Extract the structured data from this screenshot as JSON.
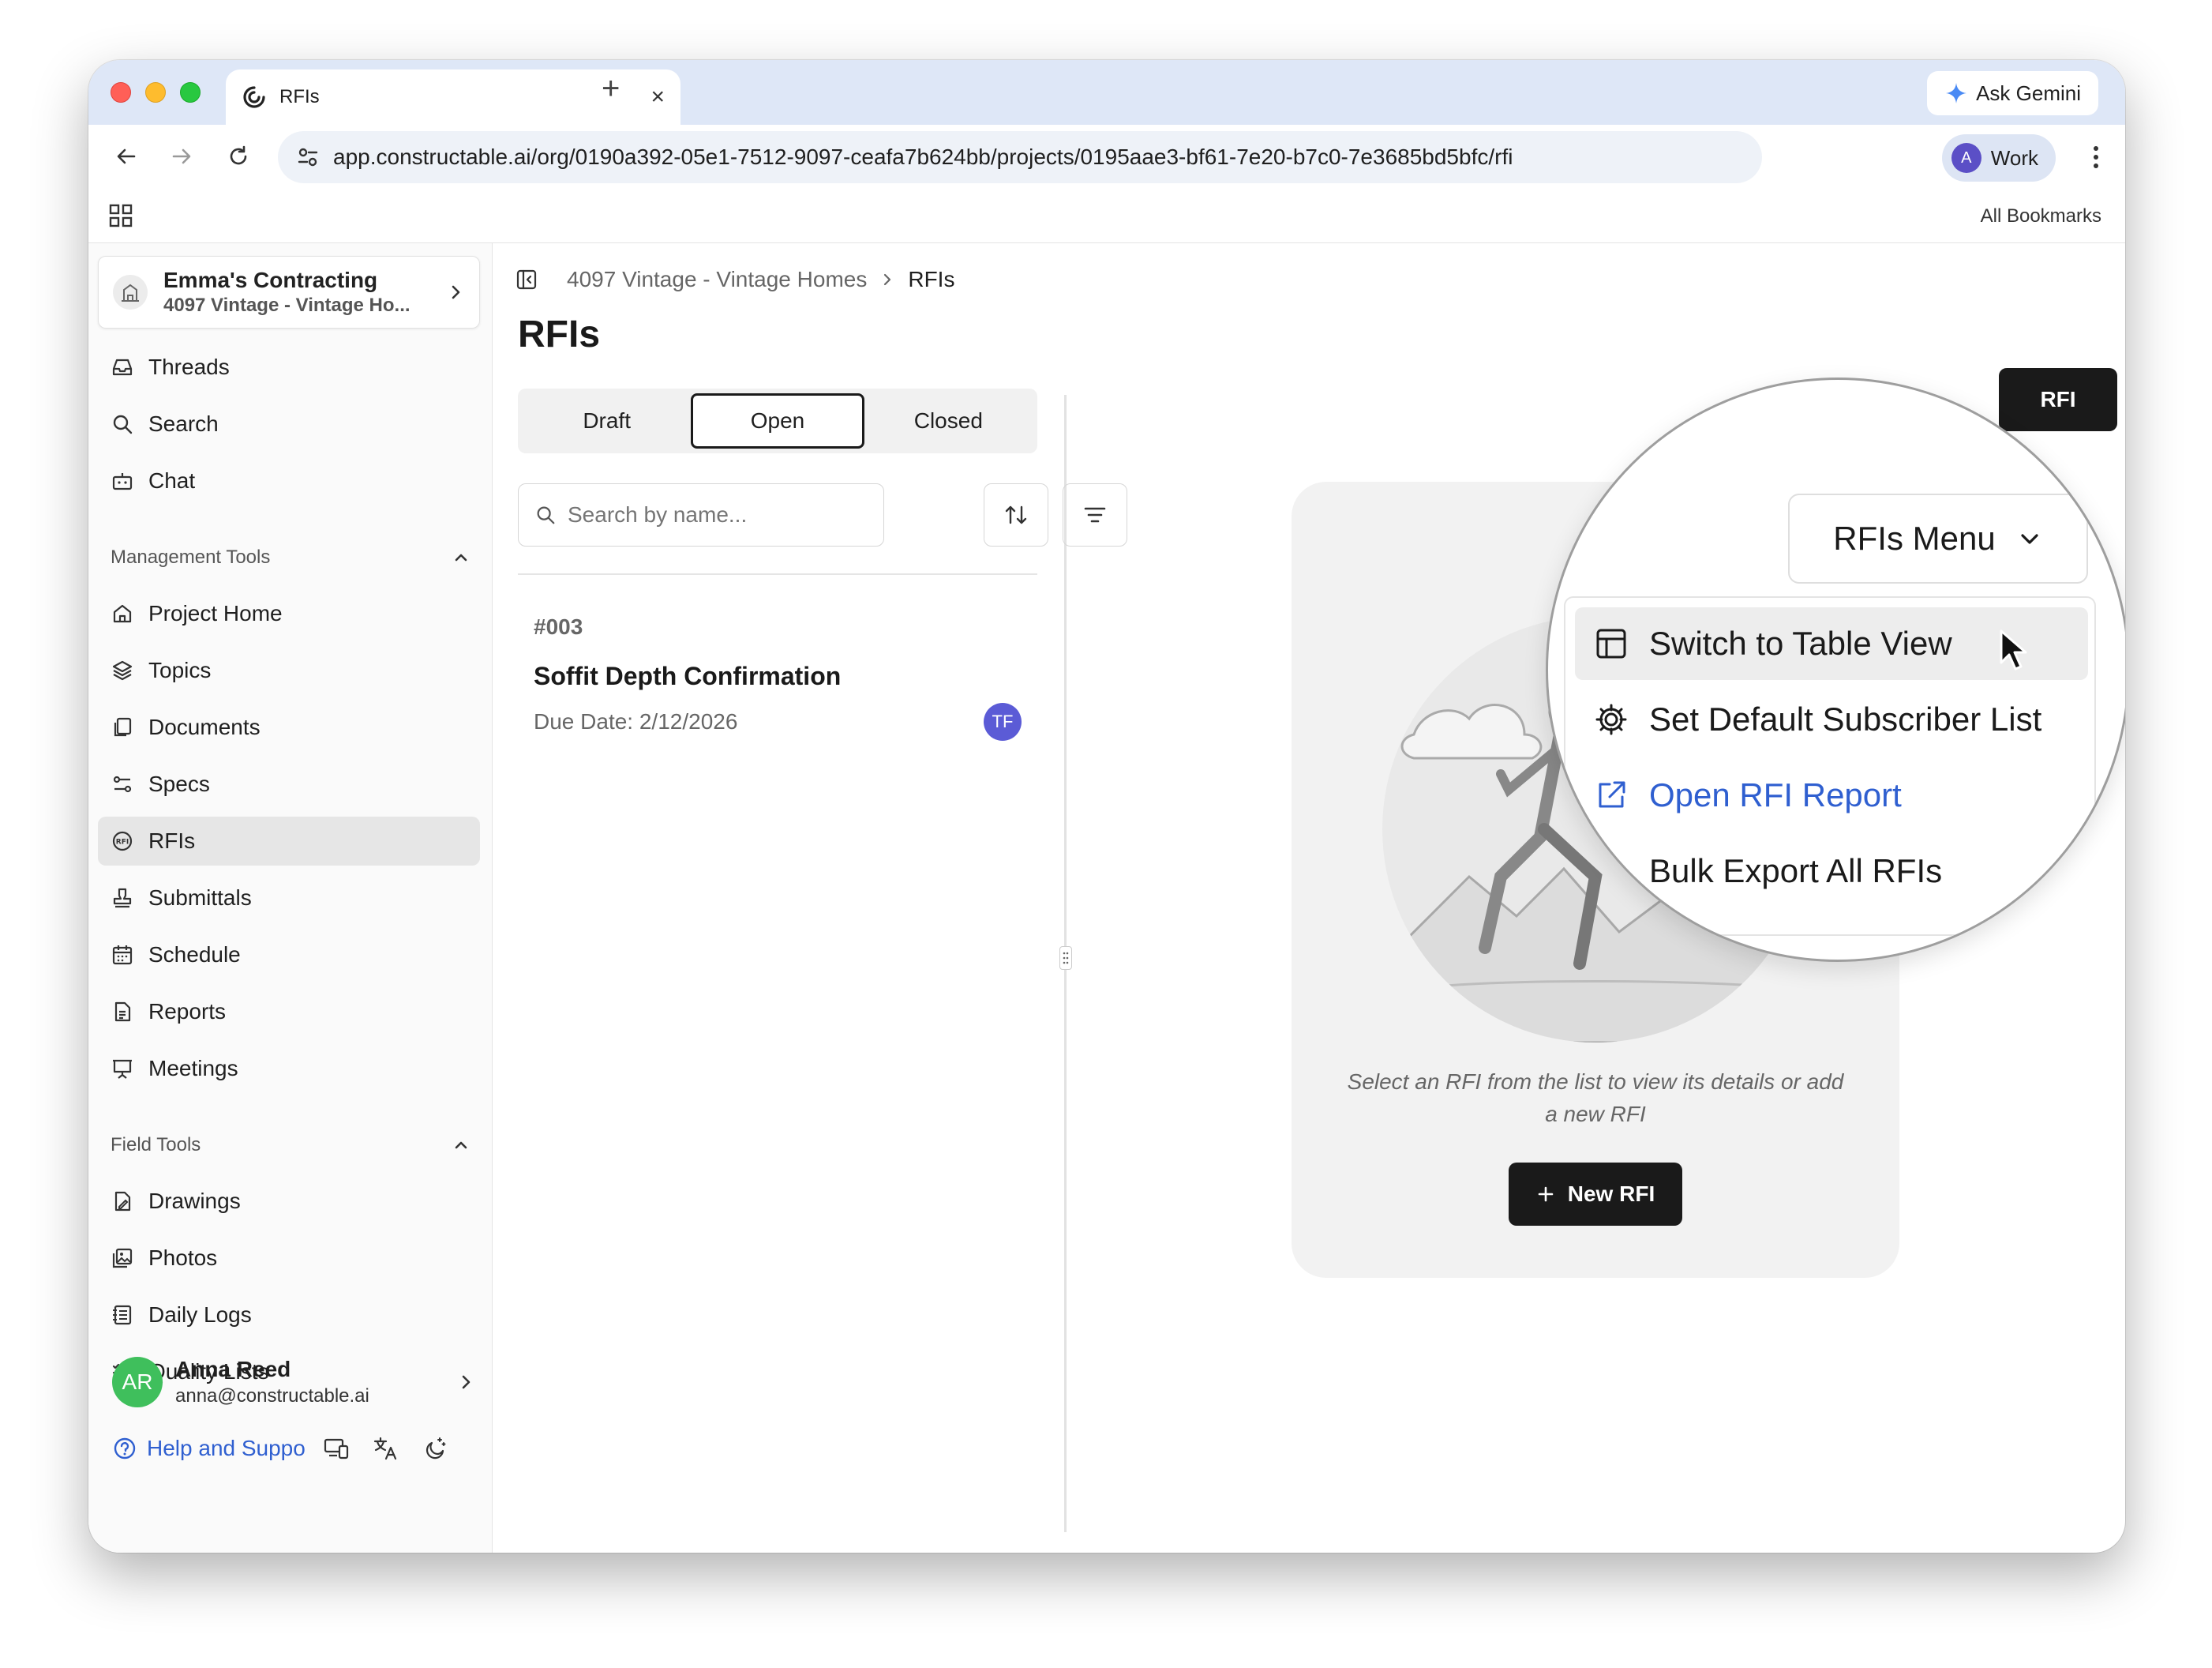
{
  "browser": {
    "tab_title": "RFIs",
    "new_tab": "+",
    "ask_gemini": "Ask Gemini",
    "url": "app.constructable.ai/org/0190a392-05e1-7512-9097-ceafa7b624bb/projects/0195aae3-bf61-7e20-b7c0-7e3685bd5bfc/rfi",
    "profile_initial": "A",
    "profile_label": "Work",
    "all_bookmarks": "All Bookmarks"
  },
  "sidebar": {
    "org_name": "Emma's Contracting",
    "org_project": "4097 Vintage - Vintage Ho...",
    "top_items": [
      {
        "label": "Threads",
        "icon": "inbox-icon"
      },
      {
        "label": "Search",
        "icon": "search-icon"
      },
      {
        "label": "Chat",
        "icon": "bot-icon"
      }
    ],
    "management_header": "Management Tools",
    "management_items": [
      {
        "label": "Project Home",
        "icon": "home-icon"
      },
      {
        "label": "Topics",
        "icon": "layers-icon"
      },
      {
        "label": "Documents",
        "icon": "documents-icon"
      },
      {
        "label": "Specs",
        "icon": "specs-icon"
      },
      {
        "label": "RFIs",
        "icon": "rfi-icon",
        "active": true
      },
      {
        "label": "Submittals",
        "icon": "stamp-icon"
      },
      {
        "label": "Schedule",
        "icon": "calendar-icon"
      },
      {
        "label": "Reports",
        "icon": "report-icon"
      },
      {
        "label": "Meetings",
        "icon": "presentation-icon"
      }
    ],
    "field_header": "Field Tools",
    "field_items": [
      {
        "label": "Drawings",
        "icon": "drawing-icon"
      },
      {
        "label": "Photos",
        "icon": "photos-icon"
      },
      {
        "label": "Daily Logs",
        "icon": "notebook-icon"
      },
      {
        "label": "Quality Lists",
        "icon": "checklist-icon"
      }
    ],
    "user_initials": "AR",
    "user_name": "Anna Reed",
    "user_email": "anna@constructable.ai",
    "help_label": "Help and Suppo"
  },
  "main": {
    "breadcrumb_project": "4097 Vintage - Vintage Homes",
    "breadcrumb_current": "RFIs",
    "title": "RFIs",
    "tabs": [
      {
        "label": "Draft"
      },
      {
        "label": "Open",
        "active": true
      },
      {
        "label": "Closed"
      }
    ],
    "search_placeholder": "Search by name...",
    "rfi": {
      "number": "#003",
      "title": "Soffit Depth Confirmation",
      "due": "Due Date: 2/12/2026",
      "assignee_initials": "TF"
    },
    "empty_text": "Select an RFI from the list to view its details or add a new RFI",
    "new_rfi_label": "New RFI",
    "top_new_rfi_label": "RFI"
  },
  "menu": {
    "button_label": "RFIs Menu",
    "items": [
      {
        "label": "Switch to Table View",
        "icon": "table-icon",
        "hover": true
      },
      {
        "label": "Set Default Subscriber List",
        "icon": "gear-icon"
      },
      {
        "label": "Open RFI Report",
        "icon": "external-link-icon",
        "link": true
      },
      {
        "label": "Bulk Export All RFIs",
        "icon": ""
      }
    ]
  },
  "colors": {
    "accent": "#2f5fd0",
    "primary_button": "#1a1a1a",
    "user_avatar": "#3fbf5c",
    "assignee_avatar": "#5b5bd6"
  }
}
